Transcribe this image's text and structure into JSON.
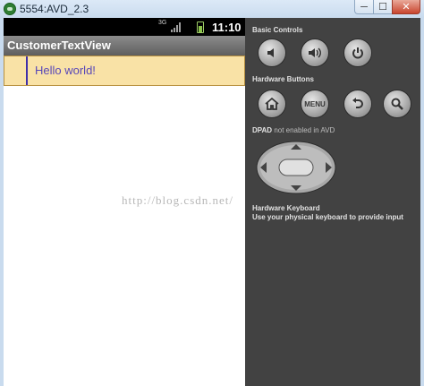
{
  "window": {
    "title": "5554:AVD_2.3",
    "minimize_label": "─",
    "maximize_label": "☐",
    "close_label": "✕"
  },
  "statusbar": {
    "signal_label": "3G",
    "clock": "11:10"
  },
  "app": {
    "title": "CustomerTextView",
    "view_text": "Hello world!"
  },
  "controls": {
    "basic_title": "Basic Controls",
    "hardware_title": "Hardware Buttons",
    "menu_label": "MENU",
    "dpad_title": "DPAD",
    "dpad_status": "not enabled in AVD",
    "keyboard_title": "Hardware Keyboard",
    "keyboard_hint": "Use your physical keyboard to provide input"
  },
  "watermark": "http://blog.csdn.net/",
  "icons": [
    "emulator-app-icon",
    "signal-icon",
    "battery-icon",
    "volume-down-icon",
    "volume-up-icon",
    "power-icon",
    "home-icon",
    "back-icon",
    "search-icon",
    "dpad-icon"
  ],
  "colors": {
    "panel_bg": "#424242",
    "view_bg": "#f9e2a6",
    "view_text": "#5847b8",
    "appbar": "#6e6e6e"
  }
}
